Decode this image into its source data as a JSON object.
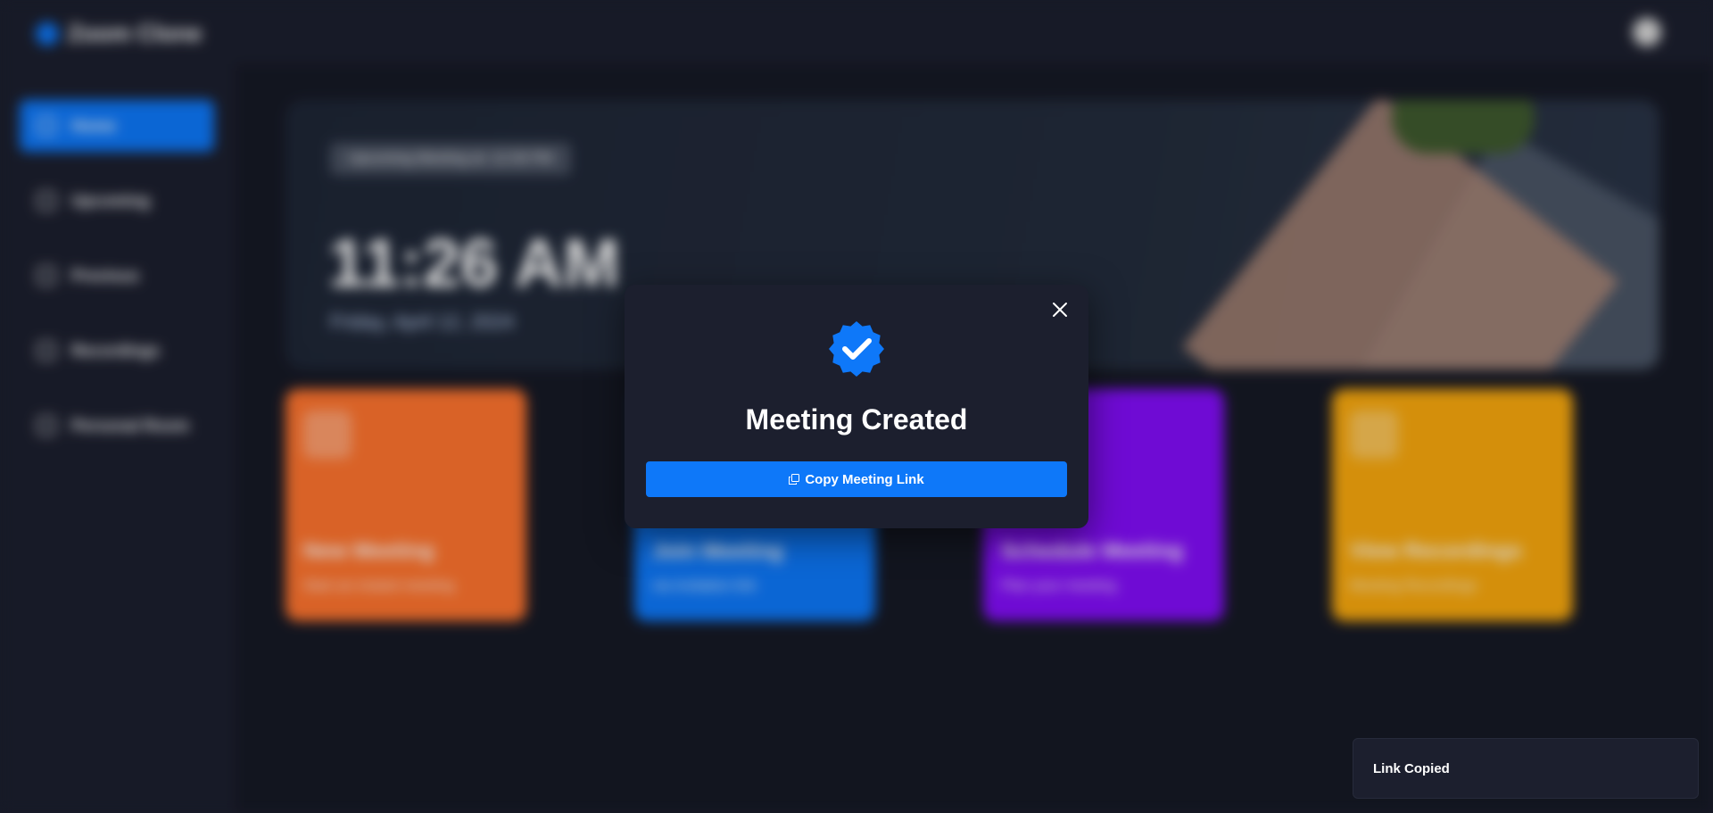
{
  "app": {
    "name": "Zoom Clone"
  },
  "sidebar": {
    "items": [
      {
        "label": "Home",
        "active": true
      },
      {
        "label": "Upcoming"
      },
      {
        "label": "Previous"
      },
      {
        "label": "Recordings"
      },
      {
        "label": "Personal Room"
      }
    ]
  },
  "hero": {
    "badge": "Upcoming Meeting at: 12:30 PM",
    "time": "11:26 AM",
    "date": "Friday, April 12, 2024"
  },
  "cards": [
    {
      "title": "New Meeting",
      "subtitle": "Start an instant meeting",
      "color": "#ff742e",
      "icon": "plus-icon"
    },
    {
      "title": "Join Meeting",
      "subtitle": "via invitation link",
      "color": "#0e78f9",
      "icon": "user-add-icon"
    },
    {
      "title": "Schedule Meeting",
      "subtitle": "Plan your meeting",
      "color": "#830ef9",
      "icon": "calendar-icon"
    },
    {
      "title": "View Recordings",
      "subtitle": "Meeting Recordings",
      "color": "#f9a90e",
      "icon": "video-icon"
    }
  ],
  "modal": {
    "title": "Meeting Created",
    "button_label": "Copy Meeting Link",
    "icon": "check-badge-icon",
    "close_icon": "close-icon"
  },
  "toast": {
    "message": "Link Copied"
  },
  "colors": {
    "accent": "#0e78f9",
    "background": "#1c1f2e",
    "main_background": "#161925"
  }
}
